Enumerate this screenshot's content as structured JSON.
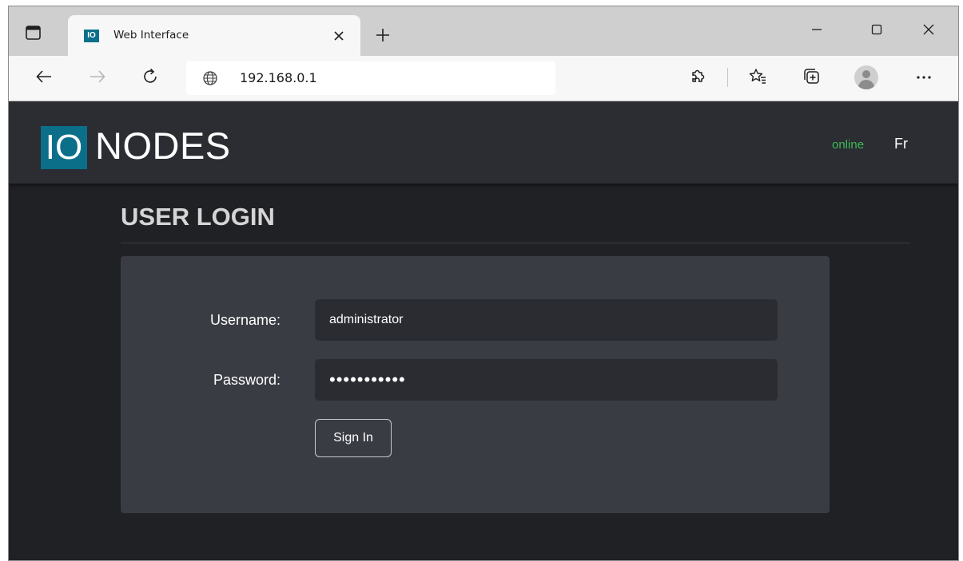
{
  "browser": {
    "tab_title": "Web Interface",
    "favicon_text": "IO",
    "url": "192.168.0.1",
    "icons": {
      "tab_actions": "tab-actions-icon",
      "close_tab": "close-icon",
      "new_tab": "plus-icon",
      "minimize": "minimize-icon",
      "maximize": "maximize-icon",
      "close_window": "close-icon",
      "back": "back-arrow-icon",
      "forward": "forward-arrow-icon",
      "refresh": "refresh-icon",
      "site_info": "globe-icon",
      "extensions": "extensions-icon",
      "favorites": "favorites-icon",
      "collections": "collections-icon",
      "profile": "profile-avatar-icon",
      "menu": "more-icon"
    }
  },
  "site": {
    "logo_box": "IO",
    "logo_text": "NODES",
    "status": "online",
    "language": "Fr",
    "colors": {
      "brand": "#0b6f8a",
      "status": "#3dbb54",
      "header_bg": "#2b2d33",
      "page_bg": "#202125",
      "panel_bg": "#3a3c44"
    }
  },
  "login": {
    "title": "USER LOGIN",
    "username_label": "Username:",
    "username_value": "administrator",
    "password_label": "Password:",
    "password_value": "•••••••••••",
    "signin_label": "Sign In"
  }
}
